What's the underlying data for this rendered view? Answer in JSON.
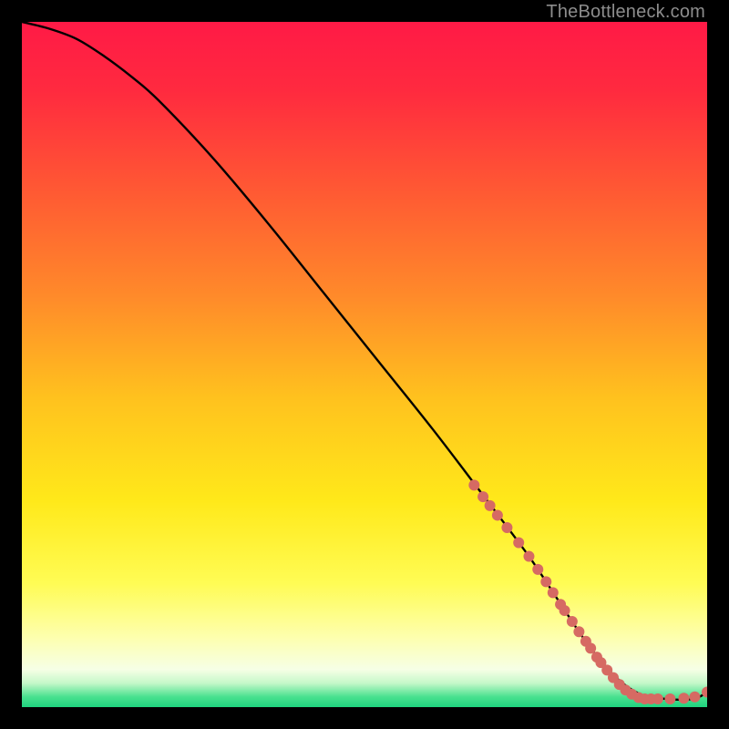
{
  "watermark": "TheBottleneck.com",
  "chart_data": {
    "type": "line",
    "title": "",
    "xlabel": "",
    "ylabel": "",
    "xlim": [
      0,
      100
    ],
    "ylim": [
      0,
      100
    ],
    "gradient_stops": [
      {
        "offset": 0.0,
        "color": "#ff1a46"
      },
      {
        "offset": 0.1,
        "color": "#ff2a3f"
      },
      {
        "offset": 0.25,
        "color": "#ff5a33"
      },
      {
        "offset": 0.4,
        "color": "#ff8a2a"
      },
      {
        "offset": 0.55,
        "color": "#ffc21e"
      },
      {
        "offset": 0.7,
        "color": "#ffe91a"
      },
      {
        "offset": 0.82,
        "color": "#fffc55"
      },
      {
        "offset": 0.9,
        "color": "#fdffb0"
      },
      {
        "offset": 0.945,
        "color": "#f6ffe6"
      },
      {
        "offset": 0.965,
        "color": "#c5f8c9"
      },
      {
        "offset": 0.985,
        "color": "#49e18f"
      },
      {
        "offset": 1.0,
        "color": "#1fd37f"
      }
    ],
    "curve": {
      "x": [
        0,
        4,
        8,
        12,
        16,
        20,
        28,
        36,
        44,
        52,
        60,
        68,
        74,
        78,
        82,
        86,
        90,
        94,
        98,
        100
      ],
      "y": [
        100,
        99,
        97.5,
        95,
        92,
        88.5,
        80,
        70.5,
        60.5,
        50.5,
        40.5,
        30,
        22,
        16,
        10,
        5,
        2,
        1.2,
        1.2,
        2.2
      ]
    },
    "markers": {
      "color": "#d66a63",
      "radius_px": 6,
      "points": [
        {
          "x": 66,
          "y": 32.4
        },
        {
          "x": 67.3,
          "y": 30.7
        },
        {
          "x": 68.3,
          "y": 29.4
        },
        {
          "x": 69.4,
          "y": 28.0
        },
        {
          "x": 70.8,
          "y": 26.2
        },
        {
          "x": 72.5,
          "y": 24.0
        },
        {
          "x": 74.0,
          "y": 22.0
        },
        {
          "x": 75.3,
          "y": 20.1
        },
        {
          "x": 76.5,
          "y": 18.3
        },
        {
          "x": 77.5,
          "y": 16.7
        },
        {
          "x": 78.6,
          "y": 15.0
        },
        {
          "x": 79.2,
          "y": 14.1
        },
        {
          "x": 80.3,
          "y": 12.5
        },
        {
          "x": 81.3,
          "y": 11.0
        },
        {
          "x": 82.3,
          "y": 9.6
        },
        {
          "x": 83.0,
          "y": 8.6
        },
        {
          "x": 83.9,
          "y": 7.3
        },
        {
          "x": 84.5,
          "y": 6.5
        },
        {
          "x": 85.4,
          "y": 5.4
        },
        {
          "x": 86.3,
          "y": 4.3
        },
        {
          "x": 87.2,
          "y": 3.3
        },
        {
          "x": 88.1,
          "y": 2.5
        },
        {
          "x": 89.0,
          "y": 1.9
        },
        {
          "x": 90.0,
          "y": 1.4
        },
        {
          "x": 90.9,
          "y": 1.2
        },
        {
          "x": 91.8,
          "y": 1.2
        },
        {
          "x": 92.8,
          "y": 1.2
        },
        {
          "x": 94.6,
          "y": 1.2
        },
        {
          "x": 96.6,
          "y": 1.3
        },
        {
          "x": 98.2,
          "y": 1.5
        },
        {
          "x": 100,
          "y": 2.2
        }
      ]
    }
  }
}
